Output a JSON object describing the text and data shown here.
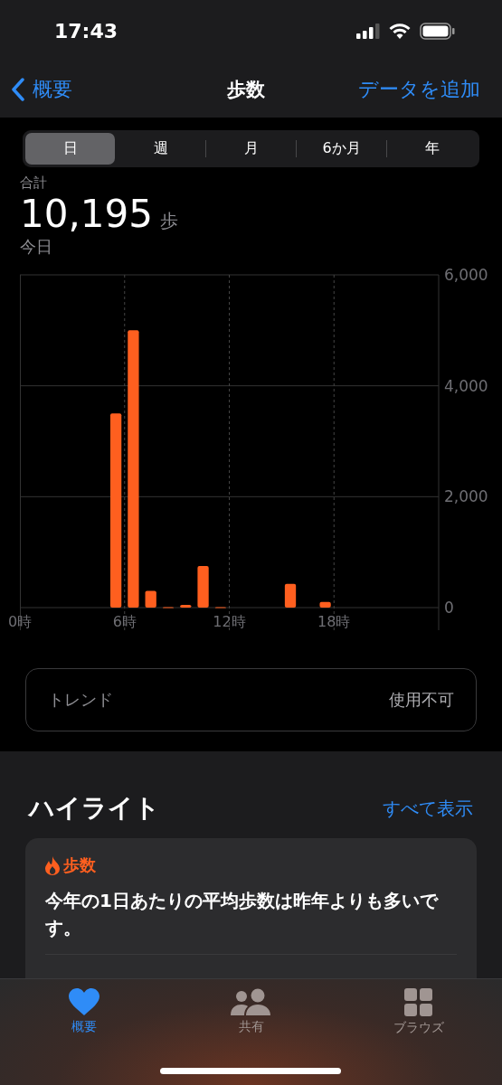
{
  "status_bar": {
    "time": "17:43"
  },
  "nav": {
    "back": "概要",
    "title": "歩数",
    "action": "データを追加"
  },
  "range_tabs": [
    {
      "label": "日",
      "selected": true
    },
    {
      "label": "週",
      "selected": false
    },
    {
      "label": "月",
      "selected": false
    },
    {
      "label": "6か月",
      "selected": false
    },
    {
      "label": "年",
      "selected": false
    }
  ],
  "summary": {
    "label": "合計",
    "value": "10,195",
    "unit": "歩",
    "period": "今日"
  },
  "chart_data": {
    "type": "bar",
    "grid": true,
    "x": [
      5.5,
      6.5,
      7.5,
      8.5,
      9.5,
      10.5,
      11.5,
      15.5,
      17.5
    ],
    "xlim": [
      0,
      24
    ],
    "series": [
      {
        "color": "#ff5f1f",
        "values": [
          3500,
          5000,
          300,
          10,
          50,
          750,
          10,
          430,
          100
        ]
      }
    ],
    "ylim": [
      0,
      6000
    ],
    "xticks": [
      {
        "value": 0,
        "label": "0時"
      },
      {
        "value": 6,
        "label": "6時"
      },
      {
        "value": 12,
        "label": "12時"
      },
      {
        "value": 18,
        "label": "18時"
      }
    ],
    "yticks": [
      {
        "value": 0,
        "label": "0"
      },
      {
        "value": 2000,
        "label": "2,000"
      },
      {
        "value": 4000,
        "label": "4,000"
      },
      {
        "value": 6000,
        "label": "6,000"
      }
    ]
  },
  "trend": {
    "label": "トレンド",
    "value": "使用不可"
  },
  "highlights": {
    "title": "ハイライト",
    "show_all": "すべて表示",
    "cards": [
      {
        "category": "歩数",
        "text": "今年の1日あたりの平均歩数は昨年よりも多いです。"
      }
    ]
  },
  "tab_bar": [
    {
      "kind": "heart",
      "label": "概要",
      "selected": true
    },
    {
      "kind": "people",
      "label": "共有",
      "selected": false
    },
    {
      "kind": "grid",
      "label": "ブラウズ",
      "selected": false
    }
  ]
}
